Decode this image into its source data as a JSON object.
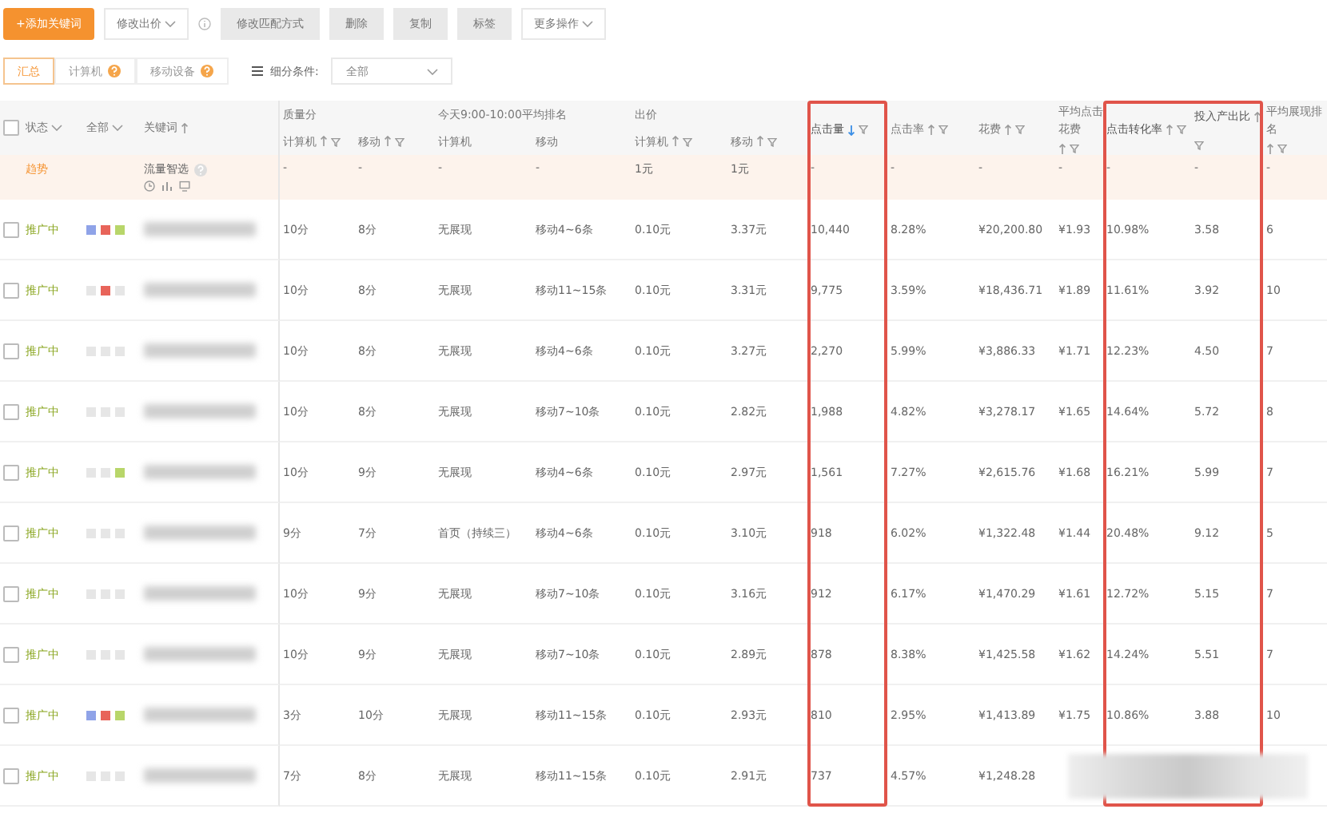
{
  "toolbar": [
    {
      "label": "+添加关键词",
      "kind": "primary"
    },
    {
      "label": "修改出价",
      "kind": "dropdown"
    },
    {
      "kind": "info"
    },
    {
      "label": "修改匹配方式",
      "kind": "plain"
    },
    {
      "label": "删除",
      "kind": "plain"
    },
    {
      "label": "复制",
      "kind": "plain"
    },
    {
      "label": "标签",
      "kind": "plain"
    },
    {
      "label": "更多操作",
      "kind": "dropdown"
    }
  ],
  "view_tabs": [
    {
      "label": "汇总",
      "selected": true,
      "help": false
    },
    {
      "label": "计算机",
      "selected": false,
      "help": true
    },
    {
      "label": "移动设备",
      "selected": false,
      "help": true
    }
  ],
  "segment_filter": {
    "label": "细分条件:",
    "value": "全部"
  },
  "table": {
    "header": {
      "checked": false,
      "status": "状态",
      "tags": "全部",
      "keyword": "关键词"
    },
    "groups": [
      {
        "label": "质量分",
        "columns": [
          {
            "label": "计算机",
            "sortable": true,
            "sorted": false,
            "highlighted": false
          },
          {
            "label": "移动",
            "sortable": true,
            "sorted": false,
            "highlighted": false
          }
        ]
      },
      {
        "label": "今天9:00-10:00平均排名",
        "columns": [
          {
            "label": "计算机",
            "sortable": false,
            "sorted": false,
            "highlighted": false
          },
          {
            "label": "移动",
            "sortable": false,
            "sorted": false,
            "highlighted": false
          }
        ]
      },
      {
        "label": "出价",
        "columns": [
          {
            "label": "计算机",
            "sortable": true,
            "sorted": false,
            "highlighted": false
          },
          {
            "label": "移动",
            "sortable": true,
            "sorted": false,
            "highlighted": false
          }
        ]
      },
      {
        "columns": [
          {
            "label": "点击量",
            "sortable": true,
            "sorted": true,
            "highlighted": true
          },
          {
            "label": "点击率",
            "sortable": true,
            "sorted": false,
            "highlighted": false
          },
          {
            "label": "花费",
            "sortable": true,
            "sorted": false,
            "highlighted": false
          },
          {
            "label": "平均点击花费",
            "sortable": true,
            "sorted": false,
            "highlighted": false
          },
          {
            "label": "点击转化率",
            "sortable": true,
            "sorted": false,
            "highlighted": true
          },
          {
            "label": "投入产出比",
            "sortable": true,
            "sorted": false,
            "highlighted": true
          },
          {
            "label": "平均展现排名",
            "sortable": true,
            "sorted": false,
            "highlighted": false
          }
        ]
      }
    ],
    "summary": {
      "label": "趋势",
      "keyword": "流量智选",
      "values": [
        "-",
        "-",
        "-",
        "-",
        "1元",
        "1元",
        "-",
        "-",
        "-",
        "-",
        "-",
        "-",
        "-"
      ]
    },
    "rows": [
      {
        "checked": false,
        "status": "推广中",
        "tags": [
          {
            "color": "#8fa3e8"
          },
          {
            "color": "#e8645a"
          },
          {
            "color": "#b8d66a"
          }
        ],
        "obscured": false,
        "values": [
          "10分",
          "8分",
          "无展现",
          "移动4~6条",
          "0.10元",
          "3.37元",
          "10,440",
          "8.28%",
          "¥20,200.80",
          "¥1.93",
          "10.98%",
          "3.58",
          "6"
        ]
      },
      {
        "checked": false,
        "status": "推广中",
        "tags": [
          {
            "color": "#e6e6e6"
          },
          {
            "color": "#e8645a"
          },
          {
            "color": "#e6e6e6"
          }
        ],
        "obscured": false,
        "values": [
          "10分",
          "8分",
          "无展现",
          "移动11~15条",
          "0.10元",
          "3.31元",
          "9,775",
          "3.59%",
          "¥18,436.71",
          "¥1.89",
          "11.61%",
          "3.92",
          "10"
        ]
      },
      {
        "checked": false,
        "status": "推广中",
        "tags": [
          {
            "color": "#e6e6e6"
          },
          {
            "color": "#e6e6e6"
          },
          {
            "color": "#e6e6e6"
          }
        ],
        "obscured": false,
        "values": [
          "10分",
          "8分",
          "无展现",
          "移动4~6条",
          "0.10元",
          "3.27元",
          "2,270",
          "5.99%",
          "¥3,886.33",
          "¥1.71",
          "12.23%",
          "4.50",
          "7"
        ]
      },
      {
        "checked": false,
        "status": "推广中",
        "tags": [
          {
            "color": "#e6e6e6"
          },
          {
            "color": "#e6e6e6"
          },
          {
            "color": "#e6e6e6"
          }
        ],
        "obscured": false,
        "values": [
          "10分",
          "8分",
          "无展现",
          "移动7~10条",
          "0.10元",
          "2.82元",
          "1,988",
          "4.82%",
          "¥3,278.17",
          "¥1.65",
          "14.64%",
          "5.72",
          "8"
        ]
      },
      {
        "checked": false,
        "status": "推广中",
        "tags": [
          {
            "color": "#e6e6e6"
          },
          {
            "color": "#e6e6e6"
          },
          {
            "color": "#b8d66a"
          }
        ],
        "obscured": false,
        "values": [
          "10分",
          "9分",
          "无展现",
          "移动4~6条",
          "0.10元",
          "2.97元",
          "1,561",
          "7.27%",
          "¥2,615.76",
          "¥1.68",
          "16.21%",
          "5.99",
          "7"
        ]
      },
      {
        "checked": false,
        "status": "推广中",
        "tags": [
          {
            "color": "#e6e6e6"
          },
          {
            "color": "#e6e6e6"
          },
          {
            "color": "#e6e6e6"
          }
        ],
        "obscured": false,
        "values": [
          "9分",
          "7分",
          "首页（持续三）",
          "移动4~6条",
          "0.10元",
          "3.10元",
          "918",
          "6.02%",
          "¥1,322.48",
          "¥1.44",
          "20.48%",
          "9.12",
          "5"
        ]
      },
      {
        "checked": false,
        "status": "推广中",
        "tags": [
          {
            "color": "#e6e6e6"
          },
          {
            "color": "#e6e6e6"
          },
          {
            "color": "#e6e6e6"
          }
        ],
        "obscured": false,
        "values": [
          "10分",
          "9分",
          "无展现",
          "移动7~10条",
          "0.10元",
          "3.16元",
          "912",
          "6.17%",
          "¥1,470.29",
          "¥1.61",
          "12.72%",
          "5.15",
          "7"
        ]
      },
      {
        "checked": false,
        "status": "推广中",
        "tags": [
          {
            "color": "#e6e6e6"
          },
          {
            "color": "#e6e6e6"
          },
          {
            "color": "#e6e6e6"
          }
        ],
        "obscured": false,
        "values": [
          "10分",
          "9分",
          "无展现",
          "移动7~10条",
          "0.10元",
          "2.89元",
          "878",
          "8.38%",
          "¥1,425.58",
          "¥1.62",
          "14.24%",
          "5.51",
          "7"
        ]
      },
      {
        "checked": false,
        "status": "推广中",
        "tags": [
          {
            "color": "#8fa3e8"
          },
          {
            "color": "#e8645a"
          },
          {
            "color": "#b8d66a"
          }
        ],
        "obscured": false,
        "values": [
          "3分",
          "10分",
          "无展现",
          "移动11~15条",
          "0.10元",
          "2.93元",
          "810",
          "2.95%",
          "¥1,413.89",
          "¥1.75",
          "10.86%",
          "3.88",
          "10"
        ]
      },
      {
        "checked": false,
        "status": "推广中",
        "tags": [
          {
            "color": "#e6e6e6"
          },
          {
            "color": "#e6e6e6"
          },
          {
            "color": "#e6e6e6"
          }
        ],
        "obscured": true,
        "values": [
          "7分",
          "8分",
          "无展现",
          "移动11~15条",
          "0.10元",
          "2.91元",
          "737",
          "4.57%",
          "¥1,248.28"
        ]
      }
    ]
  }
}
